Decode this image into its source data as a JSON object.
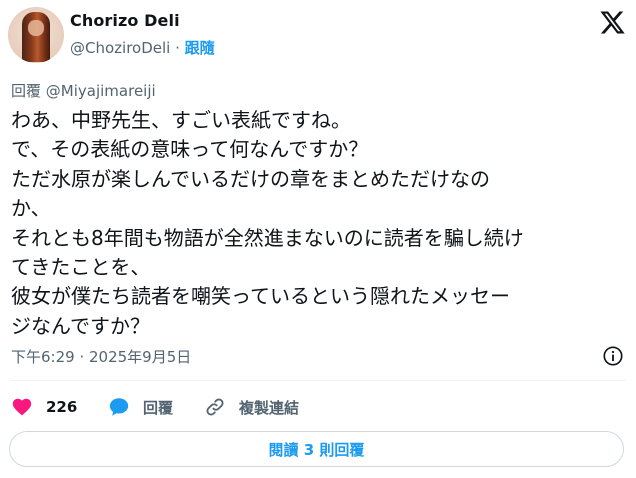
{
  "author": {
    "name": "Chorizo Deli",
    "handle": "@ChoziroDeli",
    "separator": "·",
    "follow_label": "跟隨"
  },
  "reply": {
    "prefix": "回覆",
    "to": "@Miyajimareiji"
  },
  "tweet": {
    "lines": [
      "わあ、中野先生、すごい表紙ですね。",
      "で、その表紙の意味って何なんですか？",
      "ただ水原が楽しんでいるだけの章をまとめただけなの",
      "か、",
      "それとも8年間も物語が全然進まないのに読者を騙し続け",
      "てきたことを、",
      "彼女が僕たち読者を嘲笑っているという隠れたメッセー",
      "ジなんですか？"
    ]
  },
  "timestamp": "下午6:29 · 2025年9月5日",
  "actions": {
    "likes_count": "226",
    "reply_label": "回覆",
    "copy_link_label": "複製連結"
  },
  "read_replies_label": "閱讀 3 則回覆",
  "colors": {
    "accent": "#1d9bf0",
    "like": "#f91880",
    "text": "#0f1419",
    "secondary": "#536471",
    "border": "#cfd9de"
  },
  "icons": {
    "platform_logo": "x-logo-icon",
    "info": "info-icon",
    "like": "heart-icon",
    "reply": "speech-bubble-icon",
    "copy_link": "link-icon"
  }
}
